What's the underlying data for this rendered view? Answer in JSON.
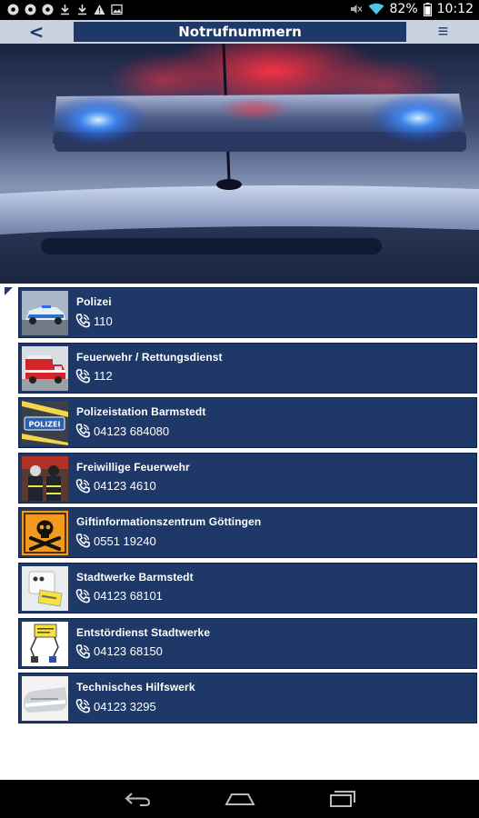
{
  "status_bar": {
    "left_icons": [
      "chrome-icon",
      "chrome-icon",
      "chrome-icon",
      "download-icon",
      "download-icon",
      "warning-icon",
      "image-icon"
    ],
    "right_icons": [
      "mute-icon",
      "wifi-icon",
      "battery-icon"
    ],
    "battery": "82%",
    "time": "10:12"
  },
  "header": {
    "back_label": "<",
    "title": "Notrufnummern",
    "menu_label": "≡"
  },
  "contacts": [
    {
      "name": "Polizei",
      "number": "110",
      "thumb": "police-car-thumbnail"
    },
    {
      "name": "Feuerwehr / Rettungsdienst",
      "number": "112",
      "thumb": "fire-truck-thumbnail"
    },
    {
      "name": "Polizeistation Barmstedt",
      "number": "04123 684080",
      "thumb": "polizei-sign-thumbnail"
    },
    {
      "name": "Freiwillige Feuerwehr",
      "number": "04123 4610",
      "thumb": "firefighters-thumbnail"
    },
    {
      "name": "Giftinformationszentrum Göttingen",
      "number": "0551 19240",
      "thumb": "poison-skull-thumbnail"
    },
    {
      "name": "Stadtwerke Barmstedt",
      "number": "04123 68101",
      "thumb": "power-meter-thumbnail"
    },
    {
      "name": "Entstördienst Stadtwerke",
      "number": "04123 68150",
      "thumb": "power-plugs-thumbnail"
    },
    {
      "name": "Technisches Hilfswerk",
      "number": "04123 3295",
      "thumb": "thw-thumbnail"
    }
  ],
  "colors": {
    "primary": "#1e3868",
    "header_bg": "#c9d3df",
    "text": "#ffffff"
  }
}
